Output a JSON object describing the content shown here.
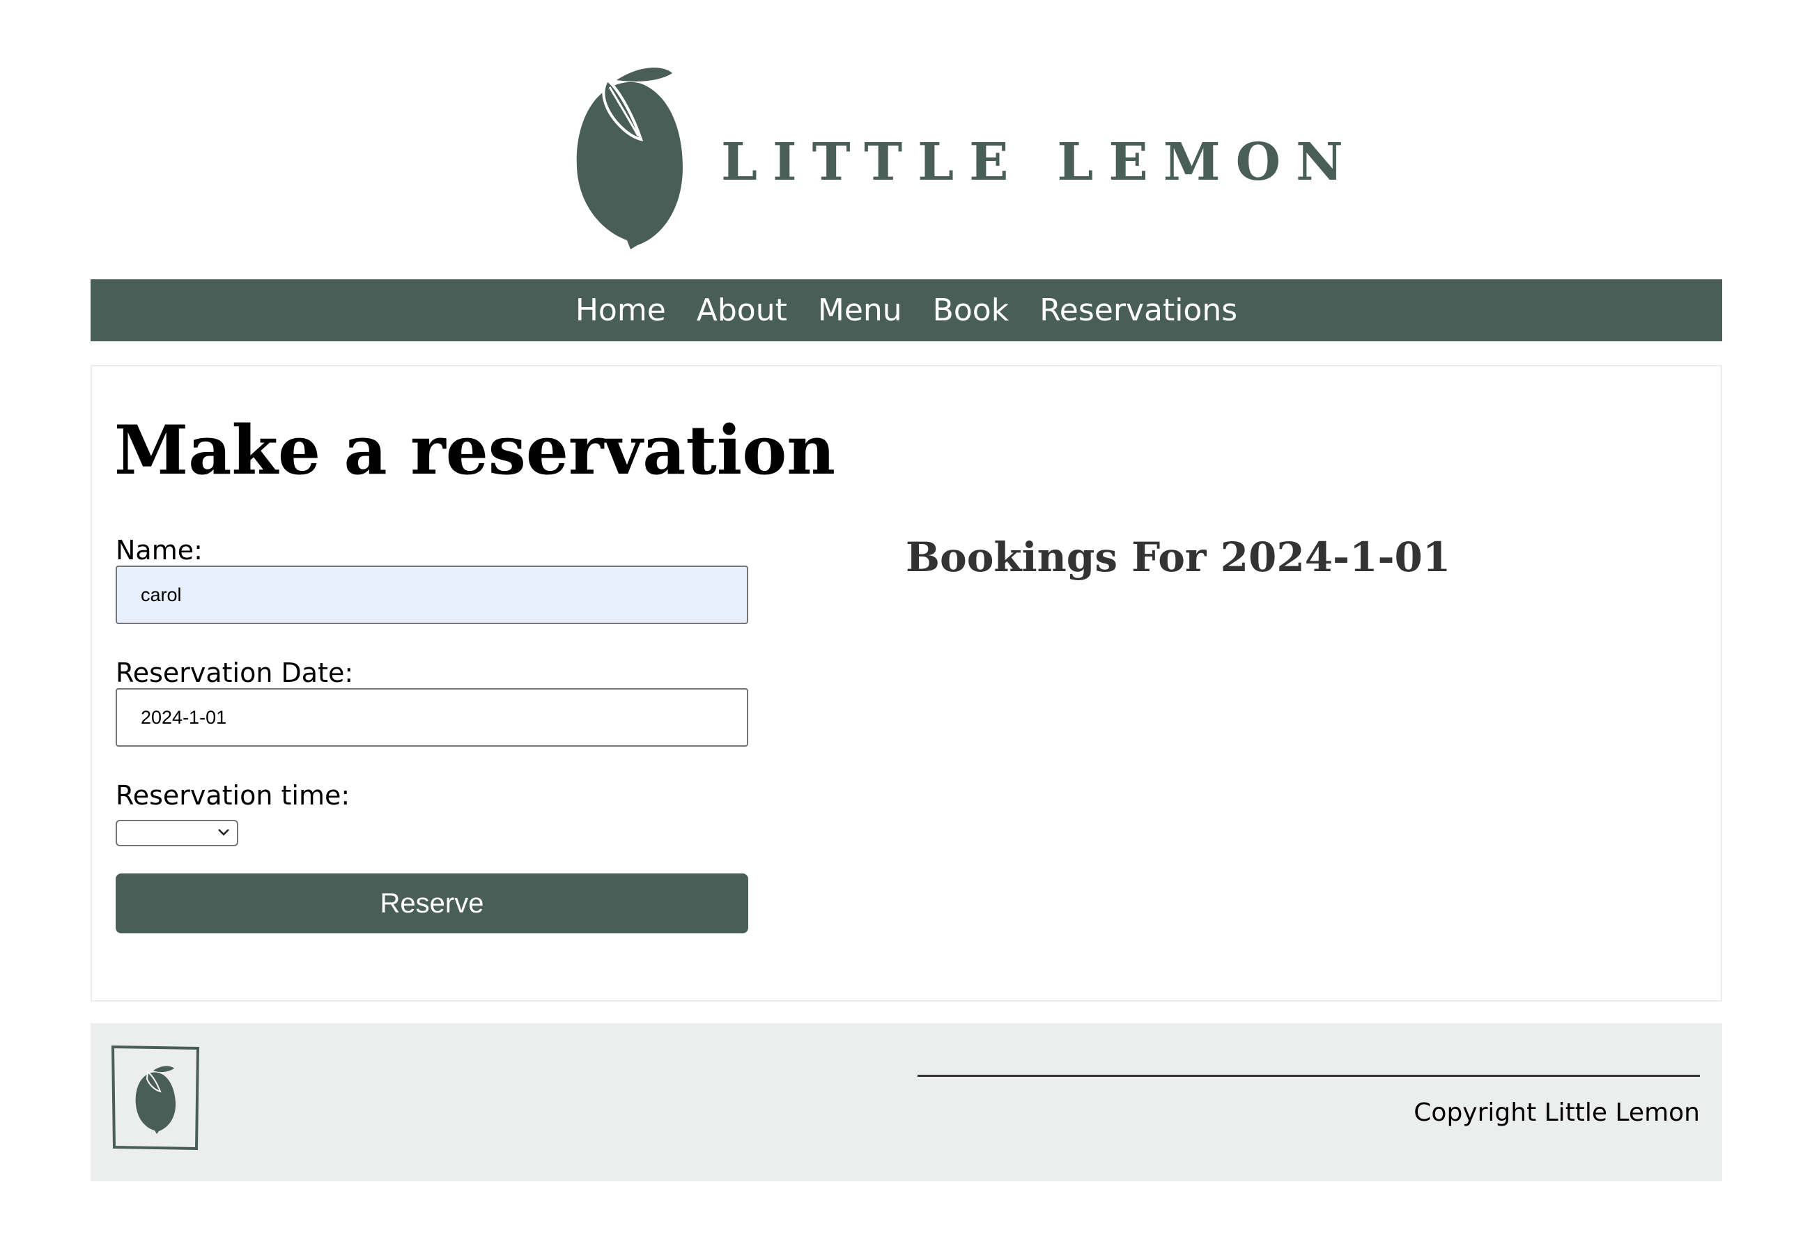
{
  "brand": {
    "name": "LITTLE LEMON",
    "color": "#495e57"
  },
  "nav": {
    "items": [
      {
        "label": "Home"
      },
      {
        "label": "About"
      },
      {
        "label": "Menu"
      },
      {
        "label": "Book"
      },
      {
        "label": "Reservations"
      }
    ]
  },
  "reservation": {
    "title": "Make a reservation",
    "name_label": "Name:",
    "name_value": "carol",
    "date_label": "Reservation Date:",
    "date_value": "2024-1-01",
    "time_label": "Reservation time:",
    "time_value": "",
    "reserve_label": "Reserve"
  },
  "bookings": {
    "title": "Bookings For 2024-1-01"
  },
  "footer": {
    "copyright": "Copyright Little Lemon"
  }
}
